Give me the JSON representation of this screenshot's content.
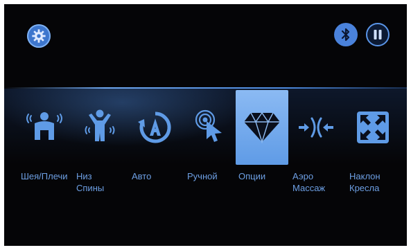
{
  "top_bar": {
    "settings_icon": "gear-icon",
    "bluetooth_icon": "bluetooth-icon",
    "pause_icon": "pause-icon"
  },
  "modes": [
    {
      "label": "Шея/Плечи",
      "icon": "neck-shoulders-icon",
      "active": false
    },
    {
      "label": "Низ\nСпины",
      "icon": "lower-back-icon",
      "active": false
    },
    {
      "label": "Авто",
      "icon": "auto-icon",
      "active": false
    },
    {
      "label": "Ручной",
      "icon": "manual-icon",
      "active": false
    },
    {
      "label": "Опции",
      "icon": "diamond-icon",
      "active": true
    },
    {
      "label": "Аэро\nМассаж",
      "icon": "air-massage-icon",
      "active": false
    },
    {
      "label": "Наклон\nКресла",
      "icon": "recline-icon",
      "active": false
    }
  ],
  "colors": {
    "accent": "#5f9be6",
    "label": "#6d9fe3",
    "background": "#050507"
  }
}
